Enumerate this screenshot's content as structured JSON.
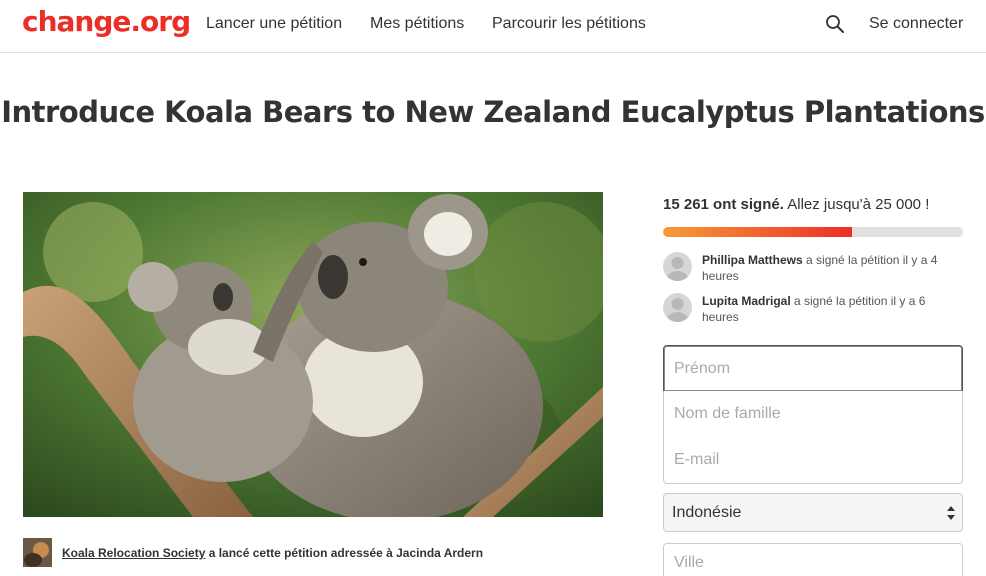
{
  "header": {
    "logo": "change.org",
    "nav": [
      "Lancer une pétition",
      "Mes pétitions",
      "Parcourir les pétitions"
    ],
    "search_icon": "search-icon",
    "login": "Se connecter",
    "brand_color": "#ed2e26"
  },
  "petition": {
    "title": "Introduce Koala Bears to New Zealand Eucalyptus Plantations",
    "image_icon": "koala-photo",
    "starter": {
      "org": "Koala Relocation Society",
      "text": " a lancé cette pétition adressée à Jacinda Ardern"
    }
  },
  "progress": {
    "signed_count": "15 261 ont signé.",
    "goal_text": " Allez jusqu'à 25 000 !",
    "fraction": 0.63
  },
  "recent_signers": [
    {
      "name": "Phillipa Matthews",
      "action": " a signé la pétition il y a 4 heures"
    },
    {
      "name": "Lupita Madrigal",
      "action": " a signé la pétition il y a 6 heures"
    }
  ],
  "form": {
    "firstname_placeholder": "Prénom",
    "lastname_placeholder": "Nom de famille",
    "email_placeholder": "E-mail",
    "country_selected": "Indonésie",
    "city_placeholder": "Ville"
  }
}
